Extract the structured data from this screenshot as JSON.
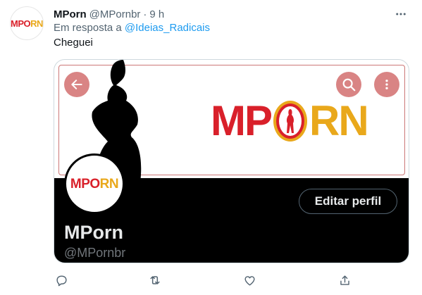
{
  "tweet": {
    "display_name": "MPorn",
    "handle": "@MPornbr",
    "dot": "·",
    "time": "9 h",
    "reply_prefix": "Em resposta a",
    "reply_mention": "@Ideias_Radicais",
    "text": "Cheguei"
  },
  "logo": {
    "part_left": "MP",
    "part_right": "RN",
    "small_left": "MP",
    "small_mid": "O",
    "small_right": "RN",
    "color_red": "#d9202a",
    "color_yellow": "#e9a81b"
  },
  "profile_card": {
    "name": "MPorn",
    "handle": "@MPornbr",
    "edit_label": "Editar perfil"
  },
  "icons": {
    "more": "more-horizontal-icon",
    "back": "back-arrow-icon",
    "search": "search-icon",
    "kebab": "more-vertical-icon",
    "reply": "reply-icon",
    "retweet": "retweet-icon",
    "like": "like-icon",
    "share": "share-icon"
  }
}
